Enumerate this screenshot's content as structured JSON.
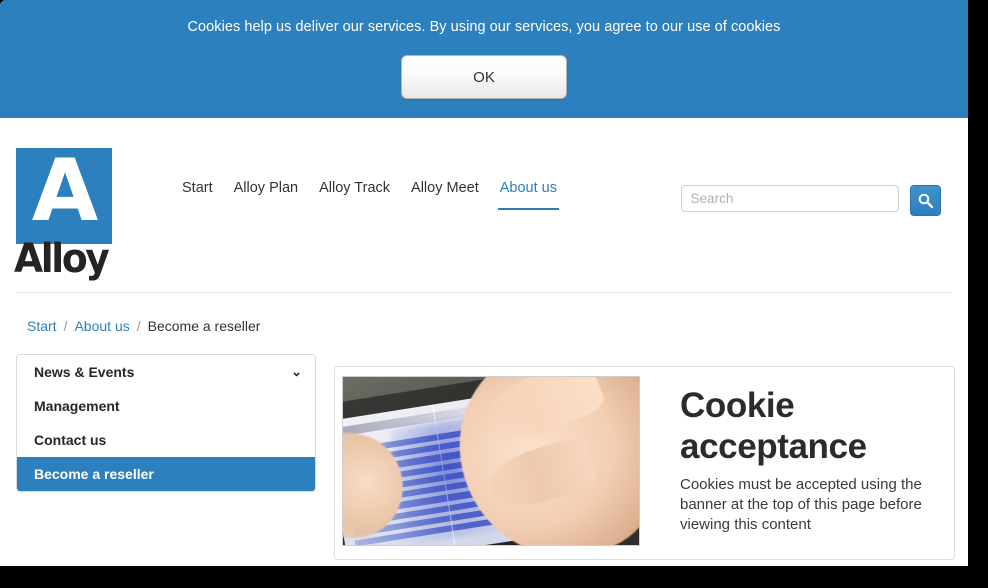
{
  "cookie_banner": {
    "message": "Cookies help us deliver our services. By using our services, you agree to our use of cookies",
    "ok_label": "OK",
    "background_color": "#2c80bd"
  },
  "header": {
    "logo": {
      "letter": "A",
      "wordmark": "Alloy",
      "square_color": "#2c80bd"
    },
    "nav": [
      {
        "label": "Start",
        "active": false
      },
      {
        "label": "Alloy Plan",
        "active": false
      },
      {
        "label": "Alloy Track",
        "active": false
      },
      {
        "label": "Alloy Meet",
        "active": false
      },
      {
        "label": "About us",
        "active": true
      }
    ],
    "search": {
      "value": "",
      "placeholder": "Search",
      "button_icon": "search-icon"
    },
    "accent_color": "#2c7fbe"
  },
  "breadcrumb": {
    "items": [
      {
        "label": "Start",
        "is_link": true
      },
      {
        "label": "About us",
        "is_link": true
      },
      {
        "label": "Become a reseller",
        "is_link": false
      }
    ],
    "separator": "/"
  },
  "sidebar": {
    "items": [
      {
        "label": "News & Events",
        "active": false,
        "icon": "chevron-down-icon"
      },
      {
        "label": "Management",
        "active": false,
        "icon": null
      },
      {
        "label": "Contact us",
        "active": false,
        "icon": null
      },
      {
        "label": "Become a reseller",
        "active": true,
        "icon": null
      }
    ],
    "active_color": "#2c80bd"
  },
  "content": {
    "image_alt": "Hand touching a tablet screen showing a blue spreadsheet",
    "title": "Cookie acceptance",
    "body": "Cookies must be accepted using the banner at the top of this page before viewing this content"
  }
}
